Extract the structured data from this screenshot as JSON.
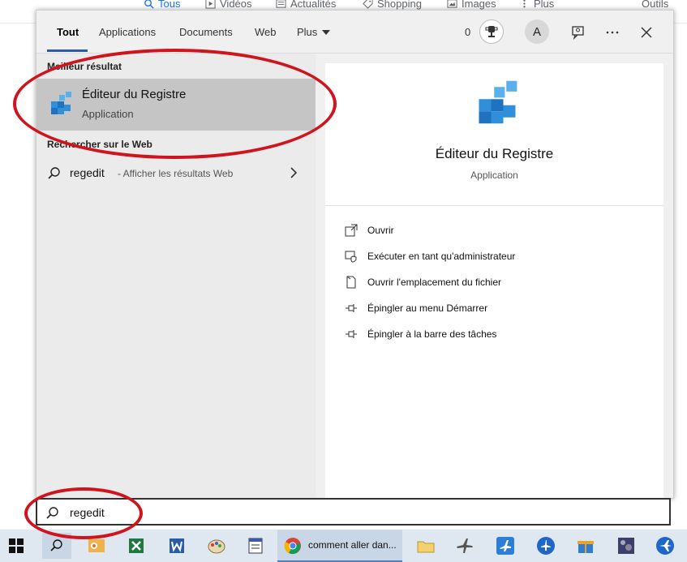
{
  "browser_tabs": [
    {
      "label": "Tous",
      "icon": "search-icon",
      "active": true
    },
    {
      "label": "Vidéos",
      "icon": "play-icon"
    },
    {
      "label": "Actualités",
      "icon": "news-icon"
    },
    {
      "label": "Shopping",
      "icon": "tag-icon"
    },
    {
      "label": "Images",
      "icon": "image-icon"
    },
    {
      "label": "Plus",
      "icon": "more-dots-icon"
    },
    {
      "label": "Outils"
    }
  ],
  "filter_tabs": [
    {
      "label": "Tout",
      "active": true
    },
    {
      "label": "Applications"
    },
    {
      "label": "Documents"
    },
    {
      "label": "Web"
    },
    {
      "label": "Plus"
    }
  ],
  "toolbar": {
    "reward_count": "0",
    "avatar_initial": "A",
    "feedback_icon": "feedback-icon",
    "more_icon": "ellipsis-icon",
    "close_icon": "close-icon"
  },
  "results": {
    "best_section": "Meilleur résultat",
    "best": {
      "title": "Éditeur du Registre",
      "subtitle": "Application",
      "icon": "registry-editor-icon"
    },
    "web_section": "Rechercher sur le Web",
    "web": {
      "query": "regedit",
      "hint": "- Afficher les résultats Web"
    }
  },
  "preview": {
    "title": "Éditeur du Registre",
    "subtitle": "Application",
    "actions": [
      {
        "label": "Ouvrir",
        "icon": "open-icon"
      },
      {
        "label": "Exécuter en tant qu'administrateur",
        "icon": "shield-admin-icon"
      },
      {
        "label": "Ouvrir l'emplacement du fichier",
        "icon": "file-location-icon"
      },
      {
        "label": "Épingler au menu Démarrer",
        "icon": "pin-icon"
      },
      {
        "label": "Épingler à la barre des tâches",
        "icon": "pin-icon"
      }
    ]
  },
  "search": {
    "value": "regedit"
  },
  "taskbar": {
    "chrome_label": "comment aller dan...",
    "items": [
      "windows-start-icon",
      "search-icon",
      "outlook-icon",
      "excel-icon",
      "word-icon",
      "paint-icon",
      "notepad-icon",
      "chrome-icon",
      "folder-icon",
      "airplane-icon",
      "airplane-app-icon",
      "airplane-blue-icon",
      "gift-icon",
      "photo-icon",
      "plane-app-icon"
    ]
  },
  "colors": {
    "accent": "#2b5aa8",
    "annotation": "#d0141e",
    "highlight": "#c5c5c5"
  }
}
